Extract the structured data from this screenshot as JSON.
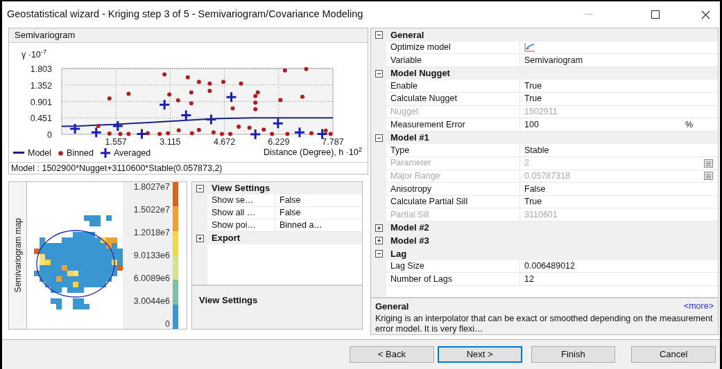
{
  "window": {
    "title": "Geostatistical wizard - Kriging step 3 of 5 - Semivariogram/Covariance Modeling"
  },
  "semivariogram_panel": {
    "title": "Semivariogram",
    "model_formula": "Model : 1502900*Nugget+3110600*Stable(0.057873,2)",
    "chart_data": {
      "type": "scatter",
      "xlabel": "Distance (Degree), h ·10$^{2}$",
      "ylabel": "γ ·10$^{-7}$",
      "grid": true,
      "legend": true,
      "xlim": [
        0,
        7.787
      ],
      "ylim": [
        0,
        1.803
      ],
      "xticks": [
        1.557,
        3.115,
        4.672,
        6.229,
        7.787
      ],
      "yticks": [
        0,
        0.451,
        0.901,
        1.352,
        1.803
      ],
      "series": [
        {
          "name": "Model",
          "type": "line",
          "color": "#1a237e",
          "x": [
            0,
            0.5,
            1,
            1.5,
            2,
            2.5,
            3,
            3.5,
            4,
            4.5,
            5,
            5.5,
            6,
            6.5,
            7,
            7.787
          ],
          "values": [
            0.22,
            0.23,
            0.25,
            0.27,
            0.3,
            0.32,
            0.35,
            0.38,
            0.41,
            0.43,
            0.44,
            0.45,
            0.45,
            0.45,
            0.45,
            0.45
          ]
        },
        {
          "name": "Binned",
          "type": "scatter",
          "color": "#b01e23",
          "x": [
            1.37,
            1.92,
            1.05,
            2.95,
            3.09,
            3.34,
            3.62,
            3.72,
            3.72,
            3.94,
            4.25,
            4.25,
            4.64,
            5.15,
            4.91,
            5.08,
            5.39,
            5.56,
            5.63,
            5.56,
            5.56,
            5.8,
            6.28,
            6.41,
            6.91,
            7.02,
            1.37,
            1.68,
            1.92,
            2.47,
            2.81,
            3.05,
            3.36,
            3.74,
            3.94,
            4.36,
            4.6,
            4.84,
            6.04,
            6.48,
            7.17,
            7.58,
            7.72
          ],
          "values": [
            0.98,
            1.11,
            0.23,
            1.64,
            1.09,
            0.93,
            1.56,
            1.15,
            0.85,
            1.44,
            1.39,
            1.19,
            1.44,
            1.39,
            0.71,
            0.21,
            0.18,
            1.05,
            1.15,
            0.87,
            0.69,
            0.13,
            0.94,
            1.75,
            1.03,
            1.79,
            0.02,
            0.01,
            0.01,
            0.03,
            0.01,
            0.03,
            0.11,
            0.03,
            0.12,
            0.05,
            0.01,
            0.01,
            0.01,
            0.01,
            0.03,
            0.1,
            0.01
          ]
        },
        {
          "name": "Averaged",
          "type": "scatter",
          "color": "#1c1cb8",
          "x": [
            0.38,
            0.99,
            1.61,
            2.3,
            2.95,
            3.57,
            4.29,
            4.87,
            5.56,
            6.21,
            6.83,
            7.48
          ],
          "values": [
            0.15,
            0.05,
            0.23,
            0.01,
            0.81,
            0.52,
            0.41,
            1.02,
            0,
            0.3,
            0.05,
            0.01
          ]
        }
      ]
    }
  },
  "semivariogram_map": {
    "axis_label": "Semivariogram map",
    "scale_labels": [
      "1.8027e7",
      "1.5022e7",
      "1.2018e7",
      "9.0133e6",
      "6.0089e6",
      "3.0044e6",
      "0"
    ],
    "color_bands": [
      {
        "color": "#e0601c"
      },
      {
        "color": "#f0a030"
      },
      {
        "color": "#f5d54a"
      },
      {
        "color": "#d9e08a"
      },
      {
        "color": "#7fbfa8"
      },
      {
        "color": "#3a96d0"
      }
    ]
  },
  "view_settings": {
    "categories": [
      {
        "label": "View Settings",
        "expanded": true,
        "children": [
          {
            "name": "Show se…",
            "value": "False"
          },
          {
            "name": "Show all …",
            "value": "False"
          },
          {
            "name": "Show poi…",
            "value": "Binned a…"
          }
        ]
      },
      {
        "label": "Export",
        "expanded": false
      }
    ],
    "description_title": "View Settings"
  },
  "properties": {
    "categories": [
      {
        "label": "General",
        "expanded": true,
        "children": [
          {
            "name": "Optimize model",
            "kind": "button",
            "disabled": false
          },
          {
            "name": "Variable",
            "kind": "text",
            "value": "Semivariogram",
            "disabled": false
          }
        ]
      },
      {
        "label": "Model Nugget",
        "expanded": true,
        "children": [
          {
            "name": "Enable",
            "kind": "text",
            "value": "True",
            "disabled": false
          },
          {
            "name": "Calculate Nugget",
            "kind": "text",
            "value": "True",
            "disabled": false
          },
          {
            "name": "Nugget",
            "kind": "text",
            "value": "1502911",
            "disabled": true
          },
          {
            "name": "Measurement Error",
            "kind": "unit",
            "value": "100",
            "unit": "%",
            "disabled": false
          }
        ]
      },
      {
        "label": "Model #1",
        "expanded": true,
        "children": [
          {
            "name": "Type",
            "kind": "text",
            "value": "Stable",
            "disabled": false
          },
          {
            "name": "Parameter",
            "kind": "calculator",
            "value": "2",
            "disabled": true
          },
          {
            "name": "Major Range",
            "kind": "calculator",
            "value": "0.05787318",
            "disabled": true
          },
          {
            "name": "Anisotropy",
            "kind": "text",
            "value": "False",
            "disabled": false
          },
          {
            "name": "Calculate Partial Sill",
            "kind": "text",
            "value": "True",
            "disabled": false
          },
          {
            "name": "Partial Sill",
            "kind": "text",
            "value": "3110601",
            "disabled": true
          }
        ]
      },
      {
        "label": "Model #2",
        "expanded": false
      },
      {
        "label": "Model #3",
        "expanded": false
      },
      {
        "label": "Lag",
        "expanded": true,
        "children": [
          {
            "name": "Lag Size",
            "kind": "text",
            "value": "0.006489012",
            "disabled": false
          },
          {
            "name": "Number of Lags",
            "kind": "text",
            "value": "12",
            "disabled": false
          }
        ]
      }
    ],
    "description": {
      "title": "General",
      "more_link": "<more>",
      "text": "Kriging is an interpolator that can be exact or smoothed depending on the measurement error model. It is very flexi…"
    }
  },
  "buttons": [
    {
      "label": "< Back",
      "focused": false
    },
    {
      "label": "Next >",
      "focused": true
    },
    {
      "label": "Finish",
      "focused": false
    },
    {
      "label": "Cancel",
      "focused": false
    }
  ]
}
